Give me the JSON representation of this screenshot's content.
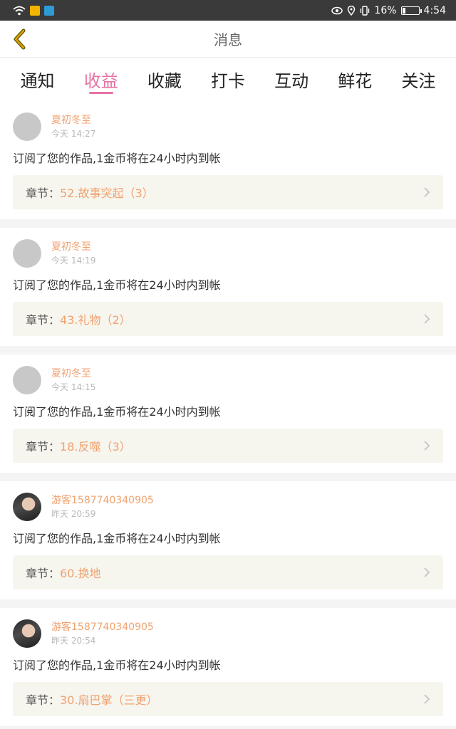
{
  "status_bar": {
    "battery": "16%",
    "time": "4:54"
  },
  "header": {
    "title": "消息"
  },
  "tabs": [
    {
      "label": "通知",
      "active": false
    },
    {
      "label": "收益",
      "active": true
    },
    {
      "label": "收藏",
      "active": false
    },
    {
      "label": "打卡",
      "active": false
    },
    {
      "label": "互动",
      "active": false
    },
    {
      "label": "鲜花",
      "active": false
    },
    {
      "label": "关注",
      "active": false
    }
  ],
  "messages": [
    {
      "user": "夏初冬至",
      "time": "今天 14:27",
      "text": "订阅了您的作品,1金币将在24小时内到帐",
      "chapter_label": "章节：",
      "chapter_title": "52.故事突起（3）"
    },
    {
      "user": "夏初冬至",
      "time": "今天 14:19",
      "text": "订阅了您的作品,1金币将在24小时内到帐",
      "chapter_label": "章节：",
      "chapter_title": "43.礼物（2）"
    },
    {
      "user": "夏初冬至",
      "time": "今天 14:15",
      "text": "订阅了您的作品,1金币将在24小时内到帐",
      "chapter_label": "章节：",
      "chapter_title": "18.反噬（3）"
    },
    {
      "user": "游客1587740340905",
      "time": "昨天 20:59",
      "text": "订阅了您的作品,1金币将在24小时内到帐",
      "chapter_label": "章节：",
      "chapter_title": "60.换地"
    },
    {
      "user": "游客1587740340905",
      "time": "昨天 20:54",
      "text": "订阅了您的作品,1金币将在24小时内到帐",
      "chapter_label": "章节：",
      "chapter_title": "30.扇巴掌（三更）"
    }
  ],
  "colors": {
    "accent": "#e573a4",
    "username": "#f0a270",
    "back_arrow": "#e0a000"
  }
}
